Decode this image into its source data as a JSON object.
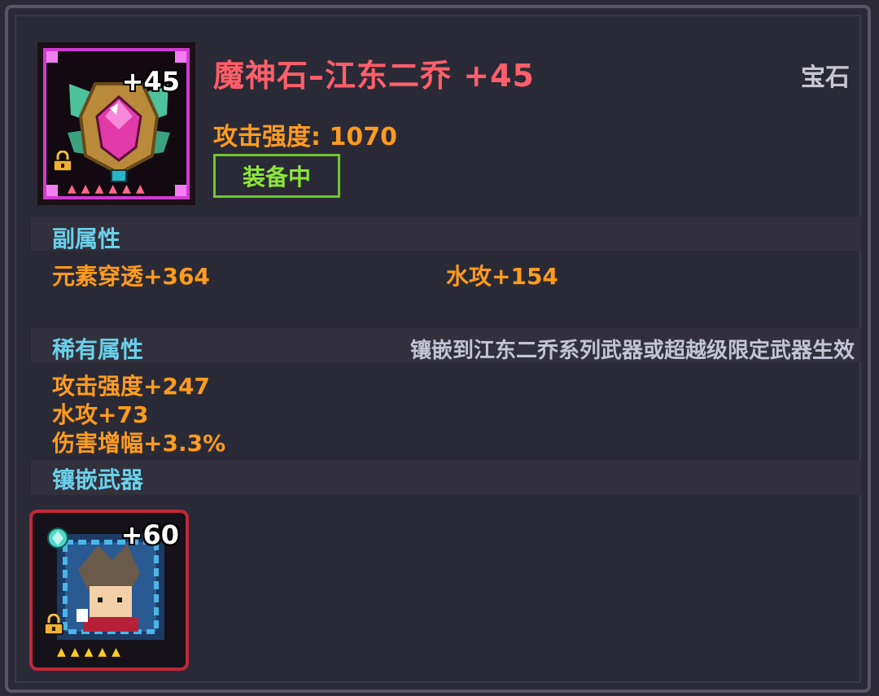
{
  "item": {
    "name": "魔神石–江东二乔 +45",
    "category": "宝石",
    "attack_label": "攻击强度: 1070",
    "status_badge": "装备中",
    "icon_level": "+45",
    "icon_star_count": 6,
    "icon_name": "gem-icon"
  },
  "sub_attributes": {
    "title": "副属性",
    "stats": [
      "元素穿透+364",
      "水攻+154"
    ]
  },
  "rare_attributes": {
    "title": "稀有属性",
    "note": "镶嵌到江东二乔系列武器或超越级限定武器生效",
    "stats": [
      "攻击强度+247",
      "水攻+73",
      "伤害增幅+3.3%"
    ]
  },
  "inlaid_weapon": {
    "title": "镶嵌武器",
    "icon_level": "+60",
    "icon_star_count": 5,
    "icon_name": "weapon-character-icon"
  },
  "colors": {
    "title": "#ff5f6a",
    "stat": "#ff9b1f",
    "section": "#6ad0ea",
    "equipped": "#8ee63a",
    "gem_frame": "#d03ad0",
    "weapon_frame": "#c0283a"
  }
}
